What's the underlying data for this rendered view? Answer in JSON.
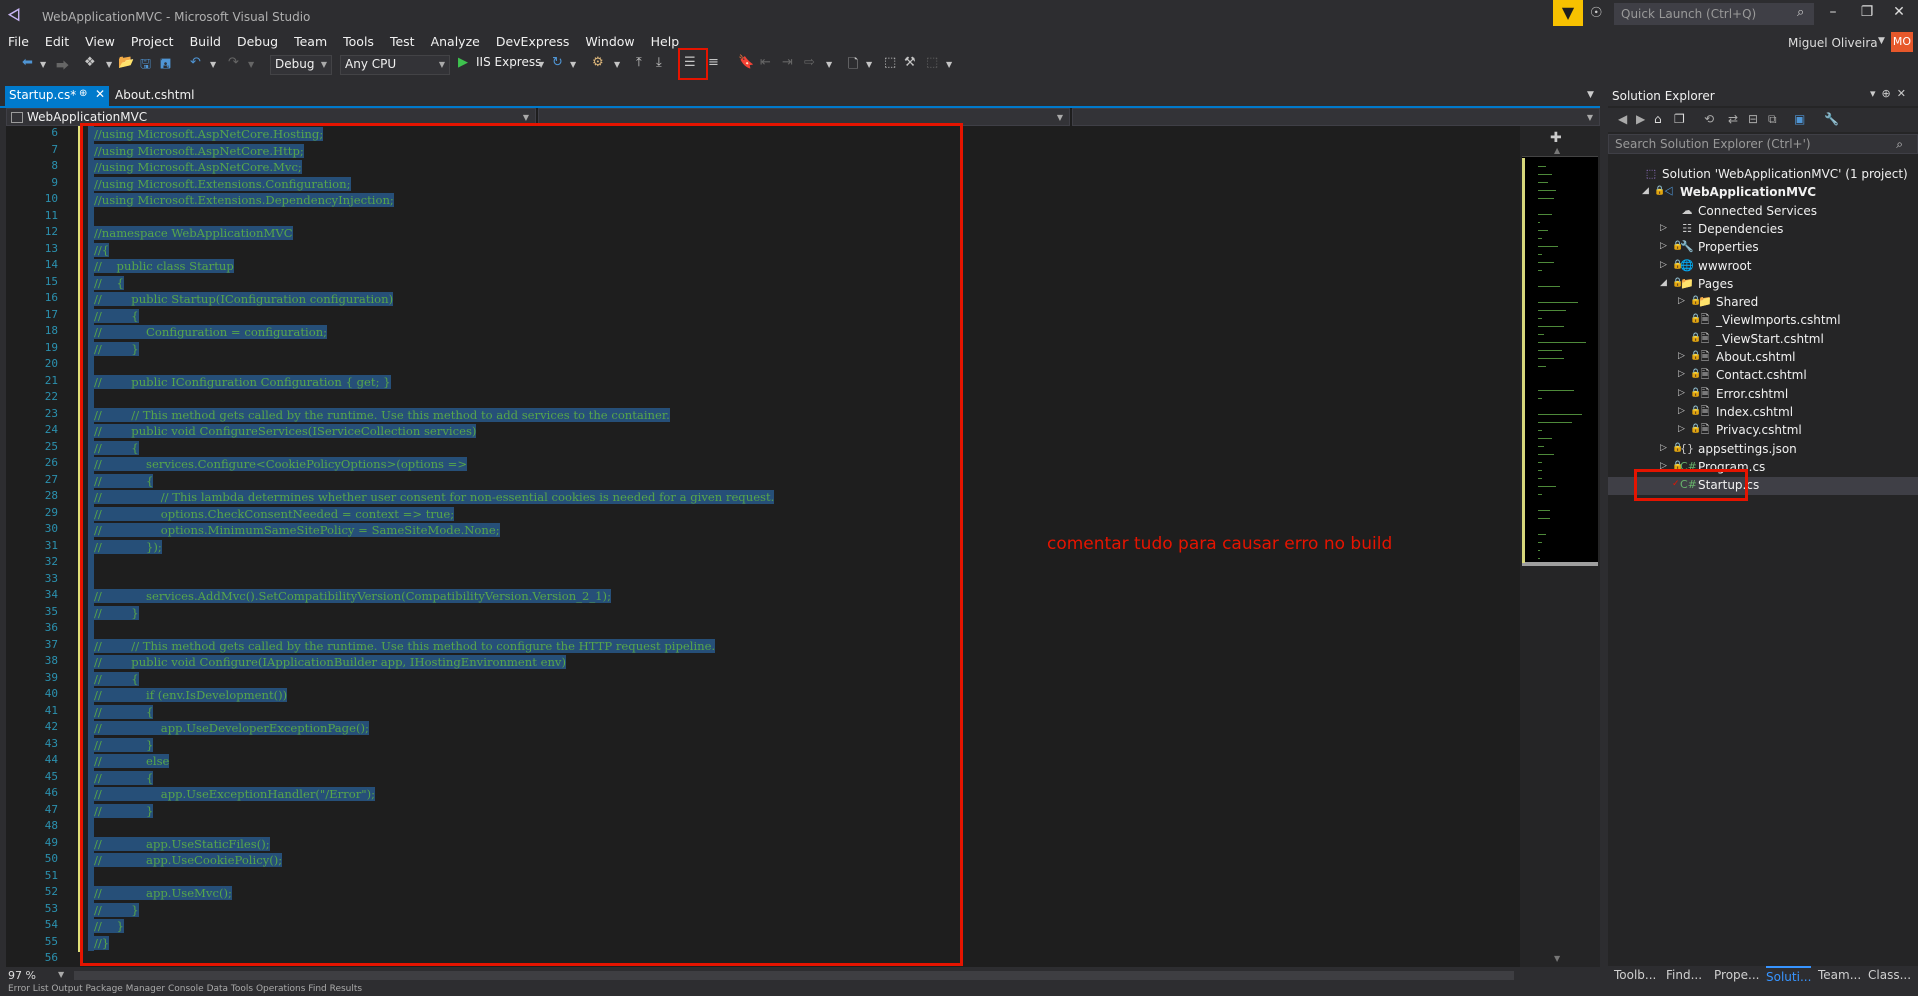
{
  "window": {
    "title": "WebApplicationMVC - Microsoft Visual Studio",
    "quick_launch_placeholder": "Quick Launch (Ctrl+Q)",
    "account_name": "Miguel Oliveira",
    "avatar_initials": "MO"
  },
  "menu": [
    "File",
    "Edit",
    "View",
    "Project",
    "Build",
    "Debug",
    "Team",
    "Tools",
    "Test",
    "Analyze",
    "DevExpress",
    "Window",
    "Help"
  ],
  "toolbar": {
    "configuration": "Debug",
    "platform": "Any CPU",
    "run_target": "IIS Express"
  },
  "tabs": {
    "active": "Startup.cs*",
    "inactive": "About.cshtml"
  },
  "navbar": {
    "project": "WebApplicationMVC"
  },
  "editor": {
    "zoom": "97 %",
    "annotation": "comentar tudo para causar erro no build",
    "lines": [
      {
        "n": "6",
        "text": "//using Microsoft.AspNetCore.Hosting;"
      },
      {
        "n": "7",
        "text": "//using Microsoft.AspNetCore.Http;"
      },
      {
        "n": "8",
        "text": "//using Microsoft.AspNetCore.Mvc;"
      },
      {
        "n": "9",
        "text": "//using Microsoft.Extensions.Configuration;"
      },
      {
        "n": "10",
        "text": "//using Microsoft.Extensions.DependencyInjection;"
      },
      {
        "n": "11",
        "text": ""
      },
      {
        "n": "12",
        "text": "//namespace WebApplicationMVC"
      },
      {
        "n": "13",
        "text": "//{"
      },
      {
        "n": "14",
        "text": "//    public class Startup"
      },
      {
        "n": "15",
        "text": "//    {"
      },
      {
        "n": "16",
        "text": "//        public Startup(IConfiguration configuration)"
      },
      {
        "n": "17",
        "text": "//        {"
      },
      {
        "n": "18",
        "text": "//            Configuration = configuration;"
      },
      {
        "n": "19",
        "text": "//        }"
      },
      {
        "n": "20",
        "text": ""
      },
      {
        "n": "21",
        "text": "//        public IConfiguration Configuration { get; }"
      },
      {
        "n": "22",
        "text": ""
      },
      {
        "n": "23",
        "text": "//        // This method gets called by the runtime. Use this method to add services to the container."
      },
      {
        "n": "24",
        "text": "//        public void ConfigureServices(IServiceCollection services)"
      },
      {
        "n": "25",
        "text": "//        {"
      },
      {
        "n": "26",
        "text": "//            services.Configure<CookiePolicyOptions>(options =>"
      },
      {
        "n": "27",
        "text": "//            {"
      },
      {
        "n": "28",
        "text": "//                // This lambda determines whether user consent for non-essential cookies is needed for a given request."
      },
      {
        "n": "29",
        "text": "//                options.CheckConsentNeeded = context => true;"
      },
      {
        "n": "30",
        "text": "//                options.MinimumSameSitePolicy = SameSiteMode.None;"
      },
      {
        "n": "31",
        "text": "//            });"
      },
      {
        "n": "32",
        "text": ""
      },
      {
        "n": "33",
        "text": ""
      },
      {
        "n": "34",
        "text": "//            services.AddMvc().SetCompatibilityVersion(CompatibilityVersion.Version_2_1);"
      },
      {
        "n": "35",
        "text": "//        }"
      },
      {
        "n": "36",
        "text": ""
      },
      {
        "n": "37",
        "text": "//        // This method gets called by the runtime. Use this method to configure the HTTP request pipeline."
      },
      {
        "n": "38",
        "text": "//        public void Configure(IApplicationBuilder app, IHostingEnvironment env)"
      },
      {
        "n": "39",
        "text": "//        {"
      },
      {
        "n": "40",
        "text": "//            if (env.IsDevelopment())"
      },
      {
        "n": "41",
        "text": "//            {"
      },
      {
        "n": "42",
        "text": "//                app.UseDeveloperExceptionPage();"
      },
      {
        "n": "43",
        "text": "//            }"
      },
      {
        "n": "44",
        "text": "//            else"
      },
      {
        "n": "45",
        "text": "//            {"
      },
      {
        "n": "46",
        "text": "//                app.UseExceptionHandler(\"/Error\");"
      },
      {
        "n": "47",
        "text": "//            }"
      },
      {
        "n": "48",
        "text": ""
      },
      {
        "n": "49",
        "text": "//            app.UseStaticFiles();"
      },
      {
        "n": "50",
        "text": "//            app.UseCookiePolicy();"
      },
      {
        "n": "51",
        "text": ""
      },
      {
        "n": "52",
        "text": "//            app.UseMvc();"
      },
      {
        "n": "53",
        "text": "//        }"
      },
      {
        "n": "54",
        "text": "//    }"
      },
      {
        "n": "55",
        "text": "//}"
      },
      {
        "n": "56",
        "text": ""
      }
    ]
  },
  "solution_explorer": {
    "title": "Solution Explorer",
    "search_placeholder": "Search Solution Explorer (Ctrl+')",
    "tree": [
      {
        "label": "Solution 'WebApplicationMVC' (1 project)",
        "icon": "solution-icon",
        "depth": 0,
        "arrow": "",
        "lock": false,
        "bold": false
      },
      {
        "label": "WebApplicationMVC",
        "icon": "project-icon",
        "depth": 1,
        "arrow": "expanded",
        "lock": true,
        "bold": true
      },
      {
        "label": "Connected Services",
        "icon": "connected-services-icon",
        "depth": 2,
        "arrow": "",
        "lock": false,
        "bold": false
      },
      {
        "label": "Dependencies",
        "icon": "dependencies-icon",
        "depth": 2,
        "arrow": "collapsed",
        "lock": false,
        "bold": false
      },
      {
        "label": "Properties",
        "icon": "wrench-icon",
        "depth": 2,
        "arrow": "collapsed",
        "lock": true,
        "bold": false
      },
      {
        "label": "wwwroot",
        "icon": "globe-icon",
        "depth": 2,
        "arrow": "collapsed",
        "lock": true,
        "bold": false
      },
      {
        "label": "Pages",
        "icon": "folder-icon",
        "depth": 2,
        "arrow": "expanded",
        "lock": true,
        "bold": false
      },
      {
        "label": "Shared",
        "icon": "folder-icon",
        "depth": 3,
        "arrow": "collapsed",
        "lock": true,
        "bold": false
      },
      {
        "label": "_ViewImports.cshtml",
        "icon": "file-icon",
        "depth": 3,
        "arrow": "",
        "lock": true,
        "bold": false
      },
      {
        "label": "_ViewStart.cshtml",
        "icon": "file-icon",
        "depth": 3,
        "arrow": "",
        "lock": true,
        "bold": false
      },
      {
        "label": "About.cshtml",
        "icon": "file-icon",
        "depth": 3,
        "arrow": "collapsed",
        "lock": true,
        "bold": false
      },
      {
        "label": "Contact.cshtml",
        "icon": "file-icon",
        "depth": 3,
        "arrow": "collapsed",
        "lock": true,
        "bold": false
      },
      {
        "label": "Error.cshtml",
        "icon": "file-icon",
        "depth": 3,
        "arrow": "collapsed",
        "lock": true,
        "bold": false
      },
      {
        "label": "Index.cshtml",
        "icon": "file-icon",
        "depth": 3,
        "arrow": "collapsed",
        "lock": true,
        "bold": false
      },
      {
        "label": "Privacy.cshtml",
        "icon": "file-icon",
        "depth": 3,
        "arrow": "collapsed",
        "lock": true,
        "bold": false
      },
      {
        "label": "appsettings.json",
        "icon": "json-icon",
        "depth": 2,
        "arrow": "collapsed",
        "lock": true,
        "bold": false
      },
      {
        "label": "Program.cs",
        "icon": "csharp-icon",
        "depth": 2,
        "arrow": "collapsed",
        "lock": true,
        "bold": false
      },
      {
        "label": "Startup.cs",
        "icon": "csharp-icon",
        "depth": 2,
        "arrow": "",
        "lock": false,
        "bold": false,
        "selected": true
      }
    ],
    "bottom_tabs": [
      "Toolb...",
      "Find...",
      "Prope...",
      "Soluti...",
      "Team...",
      "Class..."
    ],
    "active_tab": "Soluti..."
  },
  "output_tabs_text": "Error List   Output   Package Manager Console   Data Tools Operations   Find Results",
  "colors": {
    "accent": "#007acc",
    "annotation_red": "#e51400",
    "comment_green": "#57a64a",
    "selection": "#264f78",
    "line_number": "#2b91af"
  }
}
